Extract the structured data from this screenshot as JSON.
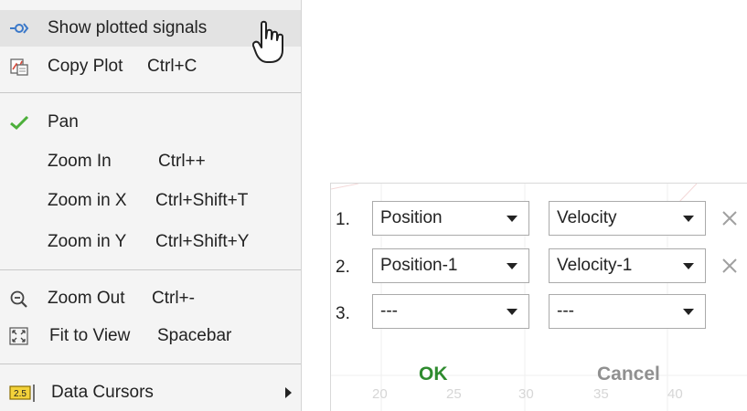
{
  "menu": {
    "items": [
      {
        "label": "Show plotted signals",
        "shortcut": "",
        "icon": "show-signals-icon"
      },
      {
        "label": "Copy Plot",
        "shortcut": "Ctrl+C",
        "icon": "copy-plot-icon"
      },
      {
        "label": "Pan",
        "shortcut": "",
        "icon": "checkmark-icon"
      },
      {
        "label": "Zoom In",
        "shortcut": "Ctrl++",
        "icon": ""
      },
      {
        "label": "Zoom in X",
        "shortcut": "Ctrl+Shift+T",
        "icon": ""
      },
      {
        "label": "Zoom in Y",
        "shortcut": "Ctrl+Shift+Y",
        "icon": ""
      },
      {
        "label": "Zoom Out",
        "shortcut": "Ctrl+-",
        "icon": "zoom-out-icon"
      },
      {
        "label": "Fit to View",
        "shortcut": "Spacebar",
        "icon": "fit-to-view-icon"
      },
      {
        "label": "Data Cursors",
        "shortcut": "",
        "icon": "data-cursors-icon",
        "submenu": true
      }
    ],
    "data_cursors_badge": "2.5",
    "colors": {
      "check": "#4caf3a",
      "signal": "#3a78c9",
      "copy": "#d84a3a"
    }
  },
  "dialog": {
    "rows": [
      {
        "num": "1.",
        "first": "Position",
        "second": "Velocity",
        "removable": true
      },
      {
        "num": "2.",
        "first": "Position-1",
        "second": "Velocity-1",
        "removable": true
      },
      {
        "num": "3.",
        "first": "---",
        "second": "---",
        "removable": false
      }
    ],
    "ok_label": "OK",
    "cancel_label": "Cancel",
    "background_ticks": [
      "20",
      "25",
      "30",
      "35",
      "40"
    ],
    "colors": {
      "ok": "#2e8b2e",
      "cancel": "#909090"
    }
  }
}
